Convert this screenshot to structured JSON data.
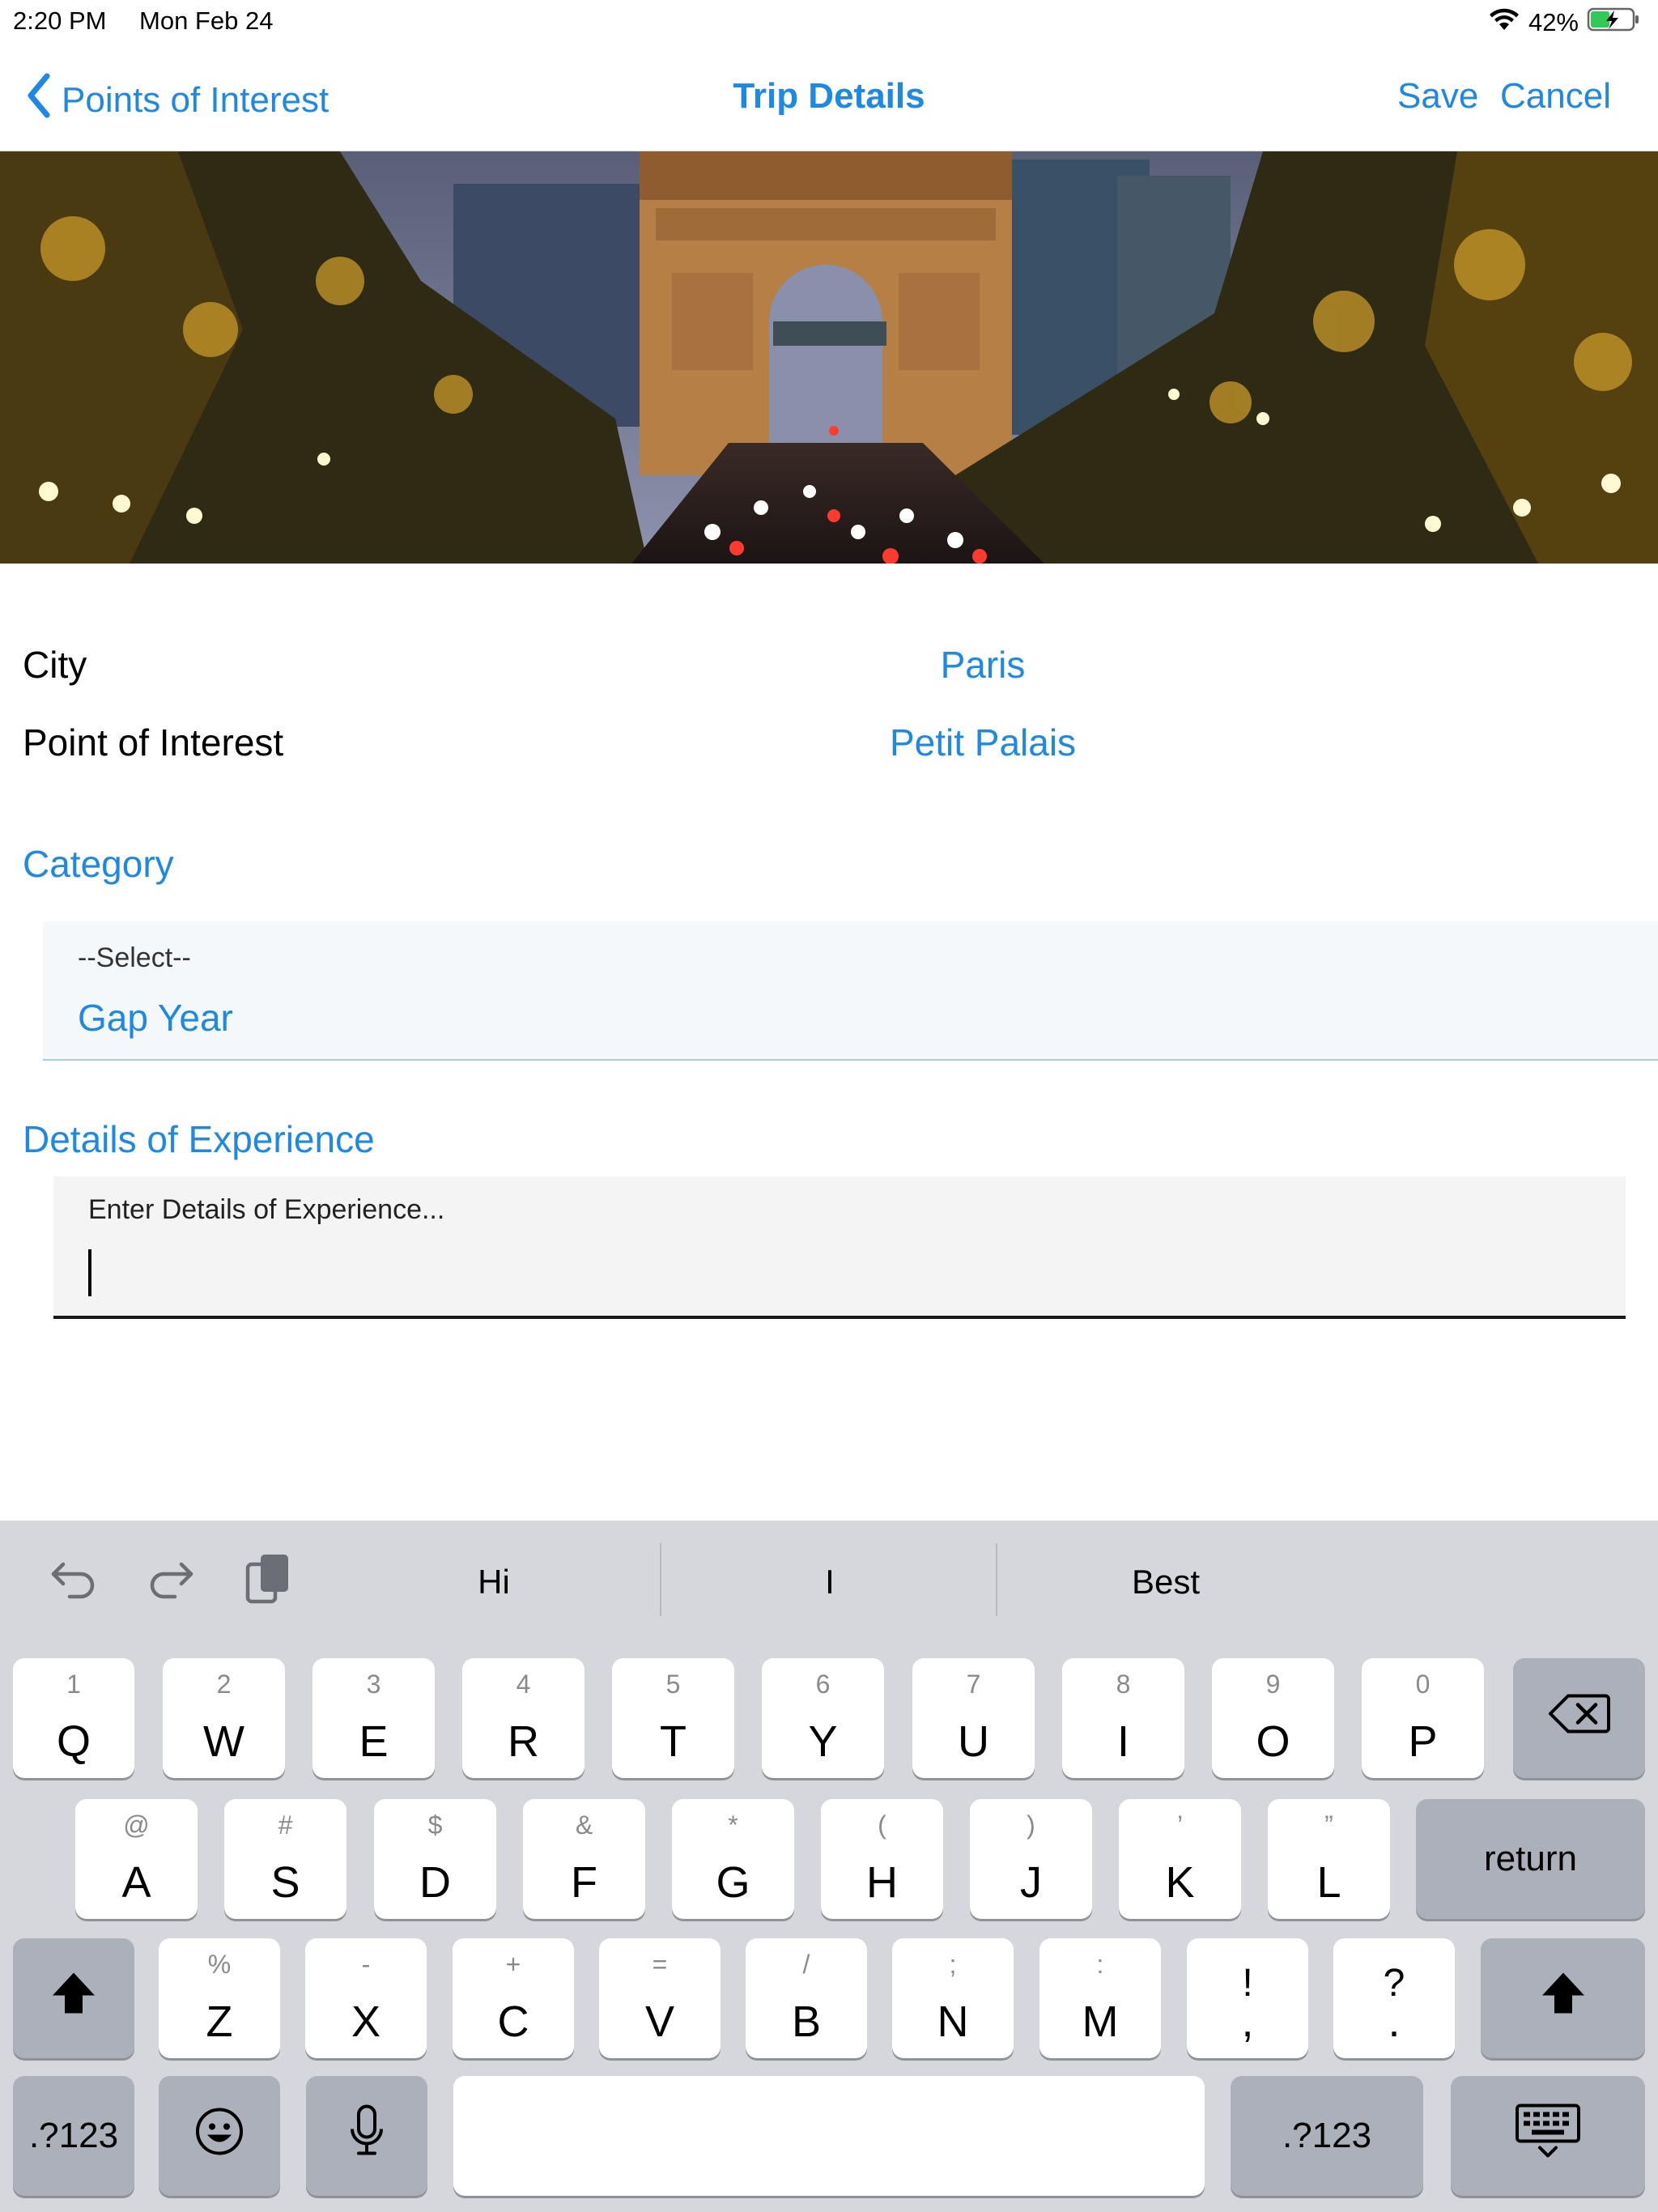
{
  "status_bar": {
    "time": "2:20 PM",
    "date": "Mon Feb 24",
    "battery": "42%",
    "icons": [
      "wifi-icon",
      "battery-charging-icon"
    ]
  },
  "nav": {
    "back_label": "Points of Interest",
    "title": "Trip Details",
    "save_label": "Save",
    "cancel_label": "Cancel",
    "accent_color": "#1e88e5"
  },
  "hero": {
    "description_icon": "arc-de-triomphe-photo"
  },
  "form": {
    "city_label": "City",
    "city_value": "Paris",
    "poi_label": "Point of Interest",
    "poi_value": "Petit Palais",
    "category_heading": "Category",
    "category_placeholder": "--Select--",
    "category_value": "Gap Year",
    "details_heading": "Details of Experience",
    "details_placeholder": "Enter Details of Experience..."
  },
  "keyboard": {
    "suggestions": [
      "Hi",
      "I",
      "Best"
    ],
    "row1": [
      {
        "hint": "1",
        "key": "Q"
      },
      {
        "hint": "2",
        "key": "W"
      },
      {
        "hint": "3",
        "key": "E"
      },
      {
        "hint": "4",
        "key": "R"
      },
      {
        "hint": "5",
        "key": "T"
      },
      {
        "hint": "6",
        "key": "Y"
      },
      {
        "hint": "7",
        "key": "U"
      },
      {
        "hint": "8",
        "key": "I"
      },
      {
        "hint": "9",
        "key": "O"
      },
      {
        "hint": "0",
        "key": "P"
      }
    ],
    "row2": [
      {
        "hint": "@",
        "key": "A"
      },
      {
        "hint": "#",
        "key": "S"
      },
      {
        "hint": "$",
        "key": "D"
      },
      {
        "hint": "&",
        "key": "F"
      },
      {
        "hint": "*",
        "key": "G"
      },
      {
        "hint": "(",
        "key": "H"
      },
      {
        "hint": ")",
        "key": "J"
      },
      {
        "hint": "’",
        "key": "K"
      },
      {
        "hint": "”",
        "key": "L"
      }
    ],
    "row3": [
      {
        "hint": "%",
        "key": "Z"
      },
      {
        "hint": "-",
        "key": "X"
      },
      {
        "hint": "+",
        "key": "C"
      },
      {
        "hint": "=",
        "key": "V"
      },
      {
        "hint": "/",
        "key": "B"
      },
      {
        "hint": ";",
        "key": "N"
      },
      {
        "hint": ":",
        "key": "M"
      }
    ],
    "punct1": {
      "top": "!",
      "bottom": ","
    },
    "punct2": {
      "top": "?",
      "bottom": "."
    },
    "return_label": "return",
    "numbers_label": ".?123"
  }
}
